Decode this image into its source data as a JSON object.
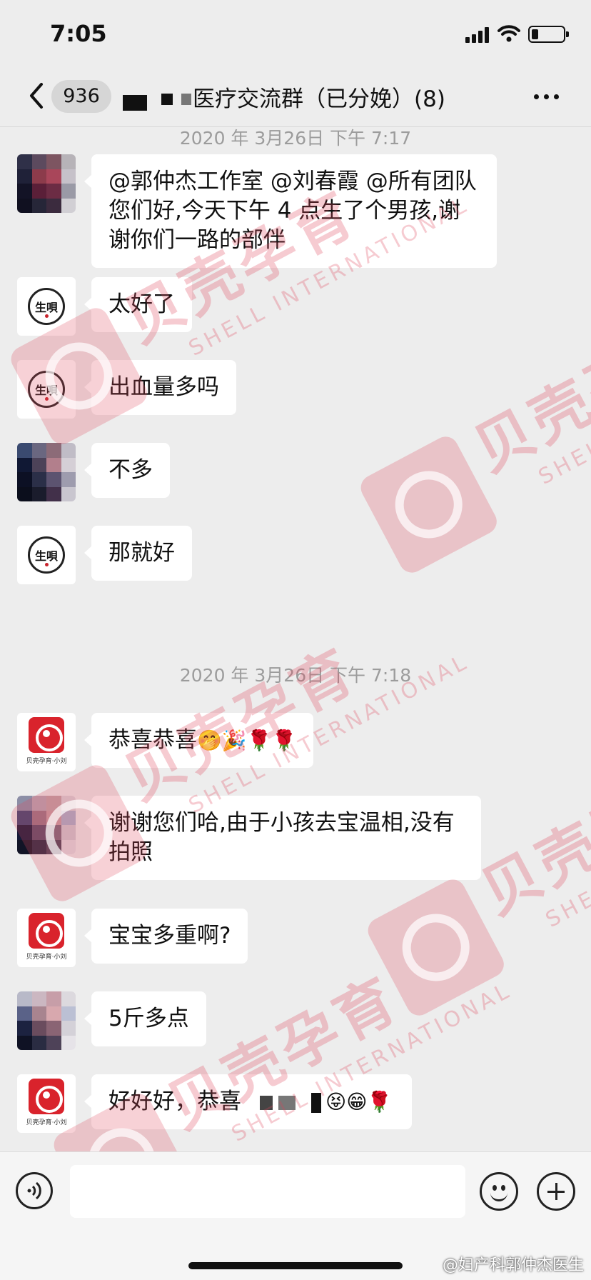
{
  "status_bar": {
    "time": "7:05"
  },
  "nav": {
    "unread_count": "936",
    "title": "医疗交流群（已分娩）(8)"
  },
  "colors": {
    "background": "#ededed",
    "bubble": "#ffffff",
    "brand_red": "#d9232c",
    "watermark": "#de465a"
  },
  "timestamps": [
    "2020 年 3月26日 下午 7:17",
    "2020 年 3月26日 下午 7:18"
  ],
  "seal_text": "生唄",
  "brand_caption": "贝壳孕育·小刘",
  "messages": [
    {
      "sender": "patient",
      "avatar": "blurred-avatar",
      "text": "@郭仲杰工作室 @刘春霞 @所有团队您们好,今天下午 4 点生了个男孩,谢谢你们一路的部伴"
    },
    {
      "sender": "seal-user",
      "avatar": "seal-avatar",
      "text": "太好了"
    },
    {
      "sender": "seal-user",
      "avatar": "seal-avatar",
      "text": "出血量多吗"
    },
    {
      "sender": "patient",
      "avatar": "blurred-avatar",
      "text": "不多"
    },
    {
      "sender": "seal-user",
      "avatar": "seal-avatar",
      "text": "那就好"
    },
    {
      "sender": "brand-user",
      "avatar": "brand-avatar",
      "text": "恭喜恭喜",
      "emojis": "🤭🎉🌹🌹"
    },
    {
      "sender": "patient",
      "avatar": "blurred-avatar",
      "text": "谢谢您们哈,由于小孩去宝温相,没有拍照"
    },
    {
      "sender": "brand-user",
      "avatar": "brand-avatar",
      "text": "宝宝多重啊?"
    },
    {
      "sender": "patient",
      "avatar": "blurred-avatar",
      "text": "5斤多点"
    },
    {
      "sender": "brand-user",
      "avatar": "brand-avatar",
      "text": "好好好，恭喜",
      "emojis": "😝😁🌹"
    }
  ],
  "watermark": {
    "brand": "贝壳孕育",
    "sub": "SHELL INTERNATIONAL"
  },
  "input": {
    "placeholder": ""
  },
  "source_watermark": "@妇产科郭仲杰医生"
}
